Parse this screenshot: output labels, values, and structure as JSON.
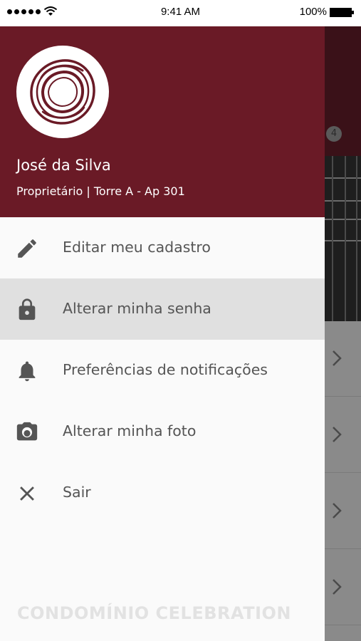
{
  "status_bar": {
    "time": "9:41 AM",
    "battery": "100%"
  },
  "drawer": {
    "user_name": "José da Silva",
    "user_role": "Proprietário | Torre A - Ap 301",
    "menu": [
      {
        "label": "Editar meu cadastro",
        "icon": "pencil-icon"
      },
      {
        "label": "Alterar minha senha",
        "icon": "lock-icon",
        "active": true
      },
      {
        "label": "Preferências de notificações",
        "icon": "bell-icon"
      },
      {
        "label": "Alterar minha foto",
        "icon": "camera-icon"
      },
      {
        "label": "Sair",
        "icon": "close-icon"
      }
    ],
    "footer_brand": "CONDOMÍNIO CELEBRATION"
  },
  "background": {
    "badge_count": "4"
  },
  "colors": {
    "header": "#6a1a26",
    "active_item": "#e0e0e0",
    "icon": "#555555",
    "footer_text": "#e2e2e2"
  }
}
